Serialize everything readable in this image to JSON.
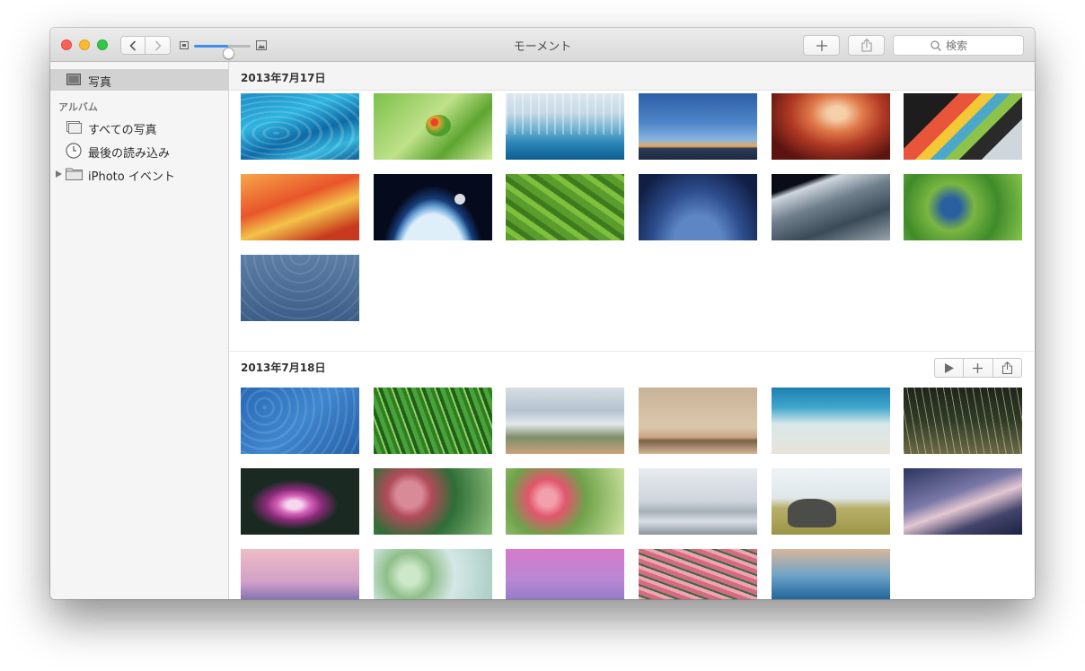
{
  "window": {
    "title": "モーメント",
    "search_placeholder": "検索",
    "thumbnail_zoom_level": 0.6
  },
  "sidebar": {
    "photos_label": "写真",
    "album_header": "アルバム",
    "items": [
      {
        "label": "すべての写真",
        "icon": "photos-stack-icon"
      },
      {
        "label": "最後の読み込み",
        "icon": "clock-icon"
      },
      {
        "label": "iPhoto イベント",
        "icon": "folder-icon"
      }
    ]
  },
  "moments": [
    {
      "date": "2013年7月17日",
      "photos": [
        "water-ripples",
        "frog-on-leaf",
        "frozen-lake",
        "blue-sky-horizon",
        "canyon",
        "colorful-polygons",
        "orange-abstract",
        "earth-moon",
        "green-fields",
        "milky-way",
        "earth-from-space",
        "green-aerial",
        "blue-waves-pattern"
      ]
    },
    {
      "date": "2013年7月18日",
      "photos": [
        "blue-pattern",
        "grass",
        "misty-hills",
        "flamingos",
        "beach",
        "reeds",
        "lotus",
        "pink-berries",
        "poppies",
        "foggy-lake",
        "elephant",
        "dusk-lake",
        "mount-fuji",
        "lily-pads",
        "purple-mist",
        "pink-grass",
        "ocean-wave"
      ]
    }
  ],
  "colors": {
    "accent": "#3b8ff2",
    "sidebar_bg": "#f5f5f5",
    "selected_bg": "#d2d2d2"
  }
}
